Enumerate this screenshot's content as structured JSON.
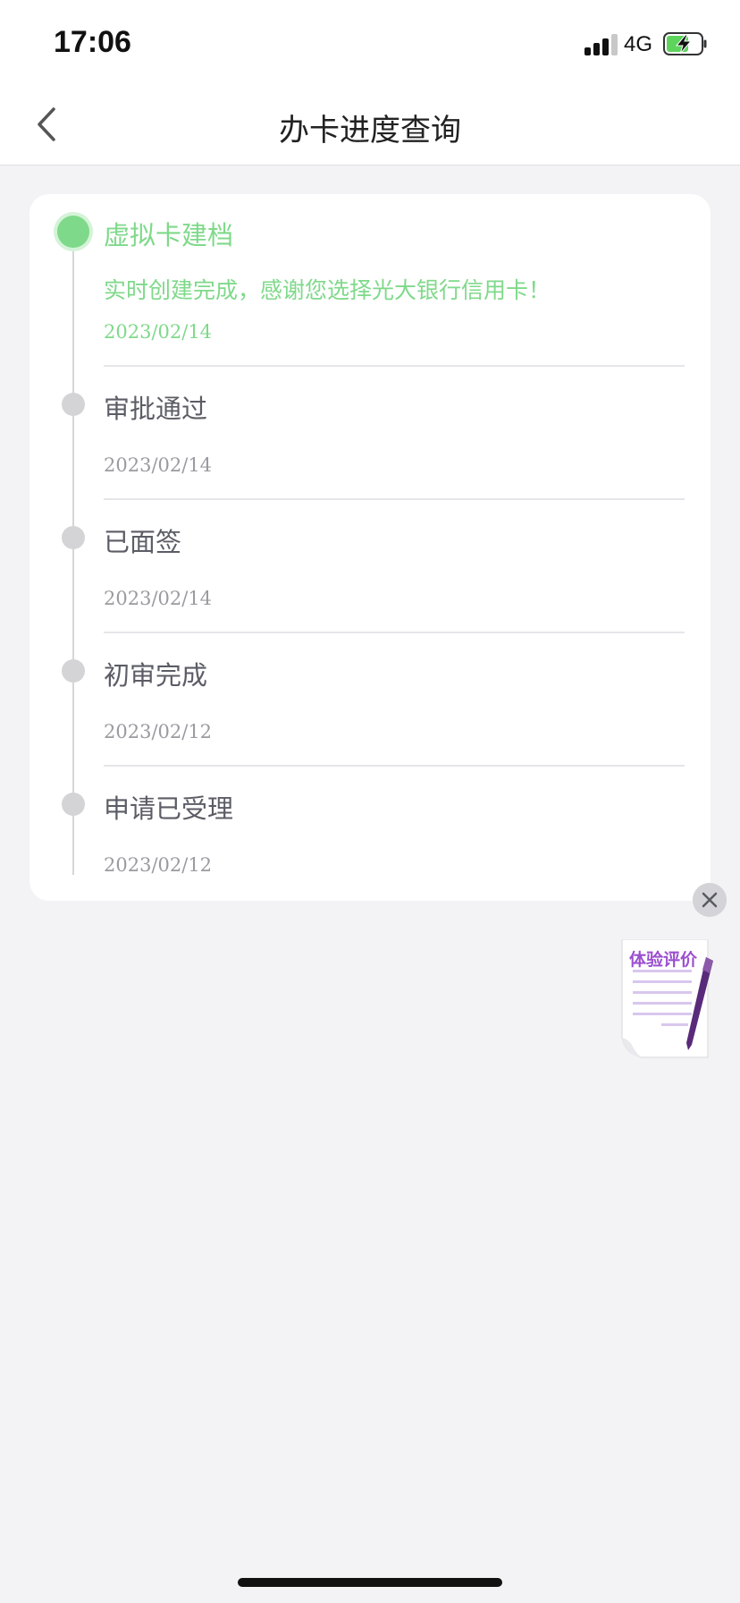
{
  "status_bar": {
    "time": "17:06",
    "network": "4G"
  },
  "nav": {
    "title": "办卡进度查询",
    "back_icon": "chevron-left-icon"
  },
  "timeline": [
    {
      "title": "虚拟卡建档",
      "desc": "实时创建完成，感谢您选择光大银行信用卡！",
      "date": "2023/02/14",
      "active": true
    },
    {
      "title": "审批通过",
      "date": "2023/02/14",
      "active": false
    },
    {
      "title": "已面签",
      "date": "2023/02/14",
      "active": false
    },
    {
      "title": "初审完成",
      "date": "2023/02/12",
      "active": false
    },
    {
      "title": "申请已受理",
      "date": "2023/02/12",
      "active": false
    }
  ],
  "floating": {
    "feedback_label": "体验评价",
    "close_icon": "close-icon"
  },
  "colors": {
    "active": "#7fd98a",
    "inactive": "#d4d4d7",
    "accent_purple": "#9b4fd0"
  }
}
